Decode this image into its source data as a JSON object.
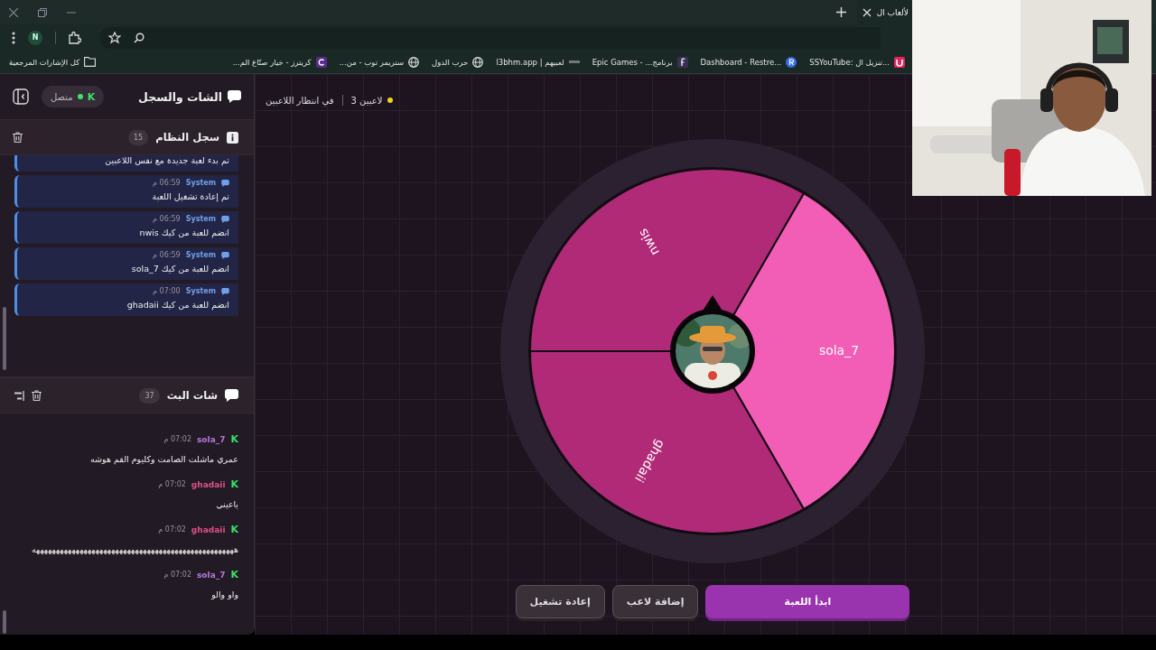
{
  "browser": {
    "tab": {
      "title": "لألعاب ال"
    },
    "profile": "N",
    "bookmarks": [
      {
        "label": "SSYouTube: تنزيل ال...",
        "kind": "u"
      },
      {
        "label": "Dashboard - Restre...",
        "kind": "r"
      },
      {
        "label": "برنامج... - Epic Games",
        "kind": "f"
      },
      {
        "label": "l3bhm.app | لعبيهم",
        "kind": "dash"
      },
      {
        "label": "حرب الدول",
        "kind": "globe"
      },
      {
        "label": "ستريمر توب - من...",
        "kind": "globe"
      },
      {
        "label": "كريترز - خيار صنّاع الم...",
        "kind": "c"
      }
    ],
    "all_bookmarks": "كل الإشارات المرجعية"
  },
  "chat_panel": {
    "title": "الشات والسجل",
    "status": {
      "badge": "K",
      "label": "متصل"
    },
    "system_log": {
      "title": "سجل النظام",
      "count": "15",
      "messages": [
        {
          "text": "تم بدء لعبة جديدة مع نفس اللاعبين"
        },
        {
          "author": "System",
          "time": "06:59 م",
          "text": "تم إعادة تشغيل اللعبة"
        },
        {
          "author": "System",
          "time": "06:59 م",
          "text": "nwis انضم للعبة من كيك"
        },
        {
          "author": "System",
          "time": "06:59 م",
          "text": "sola_7 انضم للعبة من كيك"
        },
        {
          "author": "System",
          "time": "07:00 م",
          "text": "ghadaii انضم للعبة من كيك"
        }
      ]
    },
    "stream_chat": {
      "title": "شات البث",
      "count": "37",
      "messages": [
        {
          "badge": "K",
          "author": "sola_7",
          "color": "#b57ae0",
          "time": "07:02 م",
          "text": "عمري ماشلت الصامت وكليوم القم هوشه"
        },
        {
          "badge": "K",
          "author": "ghadaii",
          "color": "#e0508a",
          "time": "07:02 م",
          "text": "ياعيني"
        },
        {
          "badge": "K",
          "author": "ghadaii",
          "color": "#e0508a",
          "time": "07:02 م",
          "text": "هههههههههههههههههههههههههههههههههههههههههههههههههههه"
        },
        {
          "badge": "K",
          "author": "sola_7",
          "color": "#b57ae0",
          "time": "07:02 م",
          "text": "واو والو"
        }
      ]
    }
  },
  "game": {
    "status": "في انتظار اللاعبين",
    "players": "3 لاعبين",
    "wheel": {
      "segments": [
        {
          "name": "sola_7",
          "color": "#f25db6"
        },
        {
          "name": "ghadaii",
          "color": "#b02a78"
        },
        {
          "name": "nwis",
          "color": "#b02a78"
        }
      ]
    },
    "buttons": [
      {
        "label": "ابدأ اللعبة",
        "kind": "primary"
      },
      {
        "label": "إضافة لاعب",
        "kind": "secondary"
      },
      {
        "label": "إعادة تشغيل",
        "kind": "secondary"
      }
    ]
  }
}
